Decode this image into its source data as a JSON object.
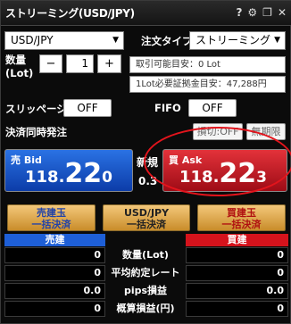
{
  "window": {
    "title": "ストリーミング(USD/JPY)",
    "help": "?",
    "gear": "⚙",
    "restore": "❐",
    "close": "✕"
  },
  "symbol": {
    "selected": "USD/JPY"
  },
  "order_type": {
    "label": "注文タイプ",
    "selected": "ストリーミング"
  },
  "quantity": {
    "label_line1": "数量",
    "label_line2": "(Lot)",
    "minus": "−",
    "value": "1",
    "plus": "+"
  },
  "info": {
    "tradable": "取引可能目安：0 Lot",
    "margin": "1Lot必要証拠金目安：47,288円"
  },
  "slippage": {
    "label": "スリッページ",
    "value": "OFF"
  },
  "fifo": {
    "label": "FIFO",
    "value": "OFF"
  },
  "settle": {
    "label": "決済同時発注",
    "stop_button": "損切:OFF",
    "expiry_button": "無期限"
  },
  "bid": {
    "tag": "売 Bid",
    "small": "118.",
    "big": "22",
    "minor": "0"
  },
  "ask": {
    "tag": "買 Ask",
    "small": "118.",
    "big": "22",
    "minor": "3"
  },
  "spread": {
    "label": "新規",
    "value": "0.3"
  },
  "bulk": {
    "sell_close_line1": "売建玉",
    "sell_close_line2": "一括決済",
    "pair_close_line1": "USD/JPY",
    "pair_close_line2": "一括決済",
    "buy_close_line1": "買建玉",
    "buy_close_line2": "一括決済"
  },
  "positions": {
    "sell_header": "売建",
    "buy_header": "買建",
    "rows": [
      {
        "label": "数量(Lot)",
        "sell": "0",
        "buy": "0"
      },
      {
        "label": "平均約定レート",
        "sell": "0",
        "buy": "0"
      },
      {
        "label": "pips損益",
        "sell": "0.0",
        "buy": "0.0"
      },
      {
        "label": "概算損益(円)",
        "sell": "0",
        "buy": "0"
      }
    ]
  }
}
